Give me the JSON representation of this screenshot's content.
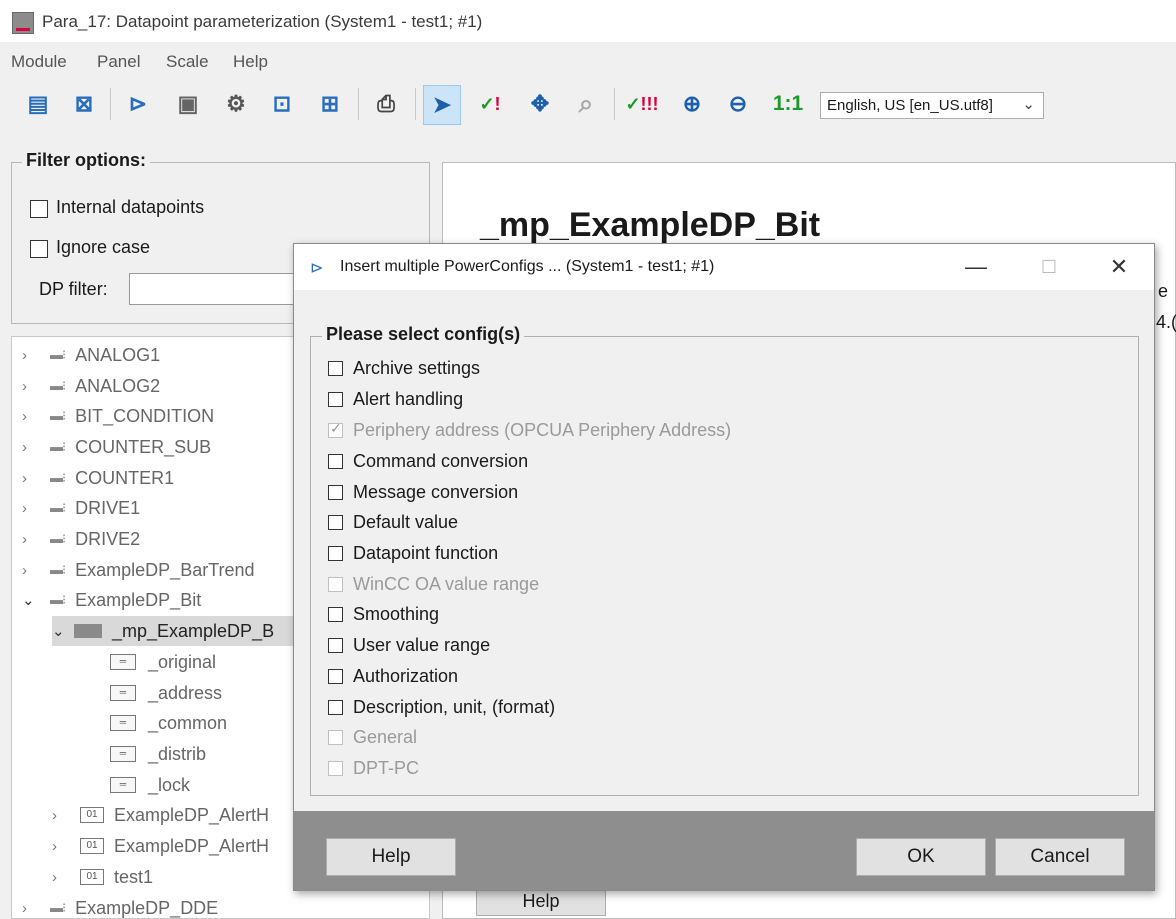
{
  "window": {
    "title": "Para_17: Datapoint parameterization (System1 - test1; #1)"
  },
  "menu": [
    "Module",
    "Panel",
    "Scale",
    "Help"
  ],
  "toolbar": {
    "zoom_reset_label": "1:1",
    "language": "English, US [en_US.utf8]"
  },
  "filter": {
    "legend": "Filter options:",
    "internal_label": "Internal datapoints",
    "ignore_case_label": "Ignore case",
    "dp_filter_label": "DP filter:",
    "dp_filter_value": ""
  },
  "tree": {
    "items": [
      "ANALOG1",
      "ANALOG2",
      "BIT_CONDITION",
      "COUNTER_SUB",
      "COUNTER1",
      "DRIVE1",
      "DRIVE2",
      "ExampleDP_BarTrend",
      "ExampleDP_Bit",
      "_mp_ExampleDP_B",
      "_original",
      "_address",
      "_common",
      "_distrib",
      "_lock",
      "ExampleDP_AlertH",
      "ExampleDP_AlertH",
      "test1",
      "ExampleDP_DDE"
    ],
    "num_icon": "01"
  },
  "right_panel": {
    "dp_title": "_mp_ExampleDP_Bit",
    "help_label": "Help",
    "edge_texts": [
      "e",
      "4.("
    ]
  },
  "dialog": {
    "title": "Insert multiple PowerConfigs ... (System1 - test1; #1)",
    "legend": "Please select config(s)",
    "configs": [
      "Archive settings",
      "Alert handling",
      "Periphery address (OPCUA Periphery Address)",
      "Command conversion",
      "Message conversion",
      "Default value",
      "Datapoint function",
      "WinCC OA value range",
      "Smoothing",
      "User value range",
      "Authorization",
      "Description, unit, (format)",
      "General",
      "DPT-PC"
    ],
    "help_label": "Help",
    "ok_label": "OK",
    "cancel_label": "Cancel",
    "minimize_glyph": "—",
    "maximize_glyph": "☐",
    "close_glyph": "✕"
  },
  "colors": {
    "accent_red": "#d8003c",
    "selection_blue": "#cce4f7",
    "icon_blue": "#2a6ebb"
  }
}
